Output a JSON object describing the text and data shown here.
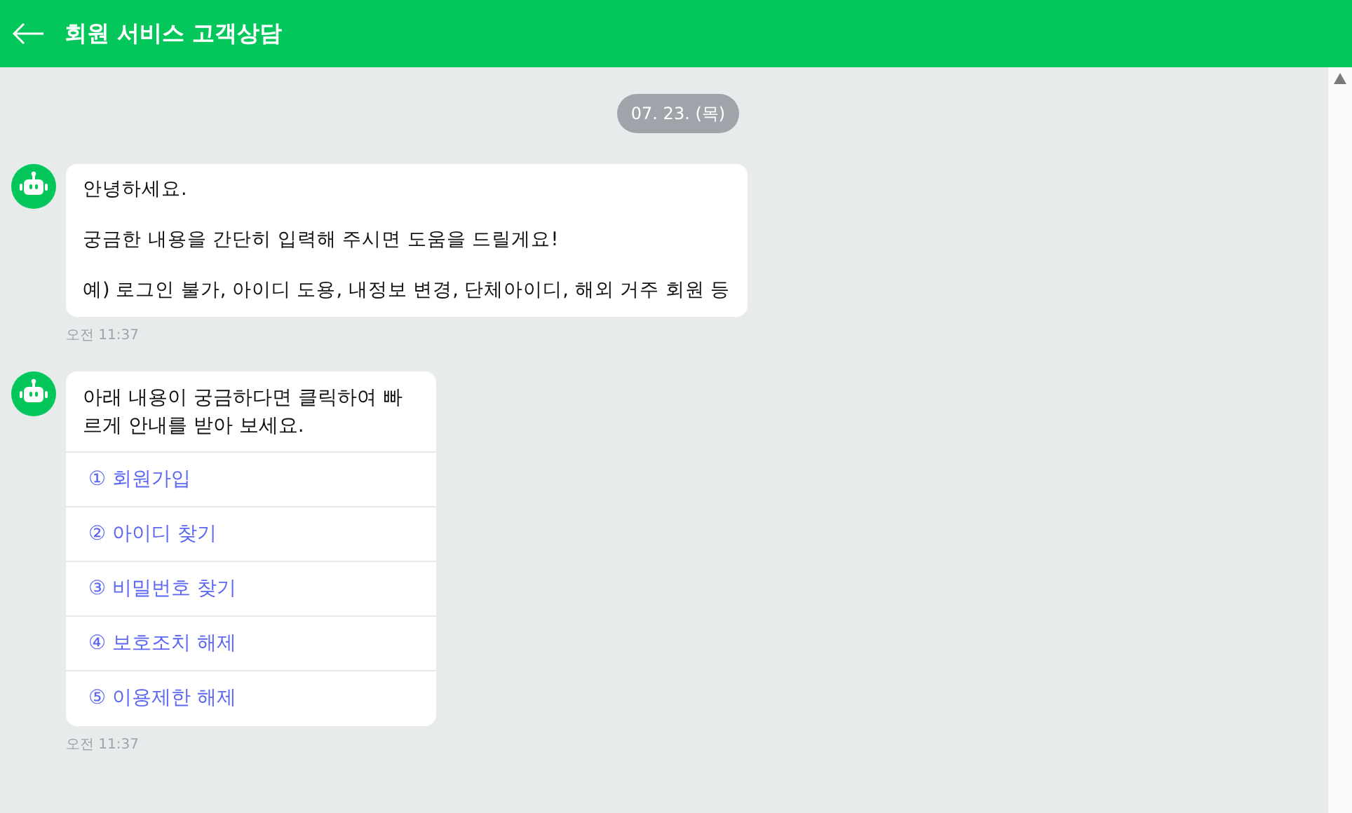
{
  "header": {
    "title": "회원 서비스 고객상담"
  },
  "date_chip": "07. 23. (목)",
  "messages": [
    {
      "kind": "text",
      "paragraphs": [
        "안녕하세요.",
        "궁금한 내용을 간단히 입력해 주시면 도움을 드릴게요!",
        "예) 로그인 불가, 아이디 도용, 내정보 변경, 단체아이디, 해외 거주 회원 등"
      ],
      "time": "오전 11:37"
    },
    {
      "kind": "menu",
      "paragraphs": [
        "아래 내용이 궁금하다면 클릭하여 빠르게 안내를 받아 보세요."
      ],
      "options": [
        "① 회원가입",
        "② 아이디 찾기",
        "③ 비밀번호 찾기",
        "④ 보호조치 해제",
        "⑤ 이용제한 해제"
      ],
      "time": "오전 11:37"
    }
  ]
}
